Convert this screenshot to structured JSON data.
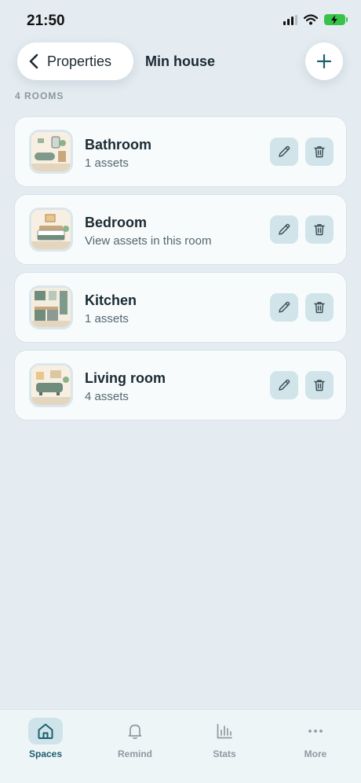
{
  "status_bar": {
    "time": "21:50"
  },
  "header": {
    "back_label": "Properties",
    "title": "Min house",
    "add_icon": "plus-icon"
  },
  "rooms_count_label": "4 ROOMS",
  "rooms": [
    {
      "name": "Bathroom",
      "subtitle": "1 assets",
      "thumb": "bathroom-illustration"
    },
    {
      "name": "Bedroom",
      "subtitle": "View assets in this room",
      "thumb": "bedroom-illustration"
    },
    {
      "name": "Kitchen",
      "subtitle": "1 assets",
      "thumb": "kitchen-illustration"
    },
    {
      "name": "Living room",
      "subtitle": "4 assets",
      "thumb": "living-room-illustration"
    }
  ],
  "nav": [
    {
      "label": "Spaces",
      "icon": "home-icon",
      "active": true
    },
    {
      "label": "Remind",
      "icon": "bell-icon",
      "active": false
    },
    {
      "label": "Stats",
      "icon": "bar-chart-icon",
      "active": false
    },
    {
      "label": "More",
      "icon": "more-dots-icon",
      "active": false
    }
  ],
  "colors": {
    "background": "#e4ecf1",
    "card": "#f7fbfc",
    "action_button": "#d0e4ea",
    "accent": "#1d5f6e",
    "battery": "#37c24a"
  }
}
